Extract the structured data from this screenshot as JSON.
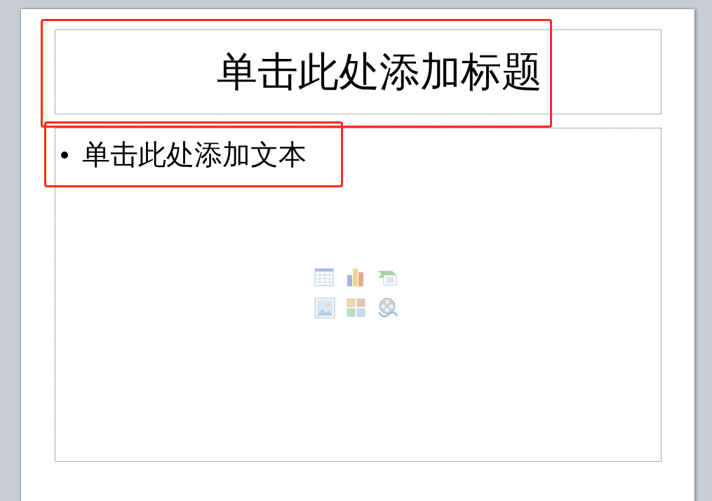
{
  "slide": {
    "title": {
      "text": "单击此处添加标题",
      "highlighted": true
    },
    "body": {
      "bullets": [
        "单击此处添加文本"
      ],
      "highlighted": true,
      "content_icons": [
        {
          "kind": "table"
        },
        {
          "kind": "chart"
        },
        {
          "kind": "smartart"
        },
        {
          "kind": "picture"
        },
        {
          "kind": "clipart"
        },
        {
          "kind": "media"
        }
      ]
    }
  }
}
